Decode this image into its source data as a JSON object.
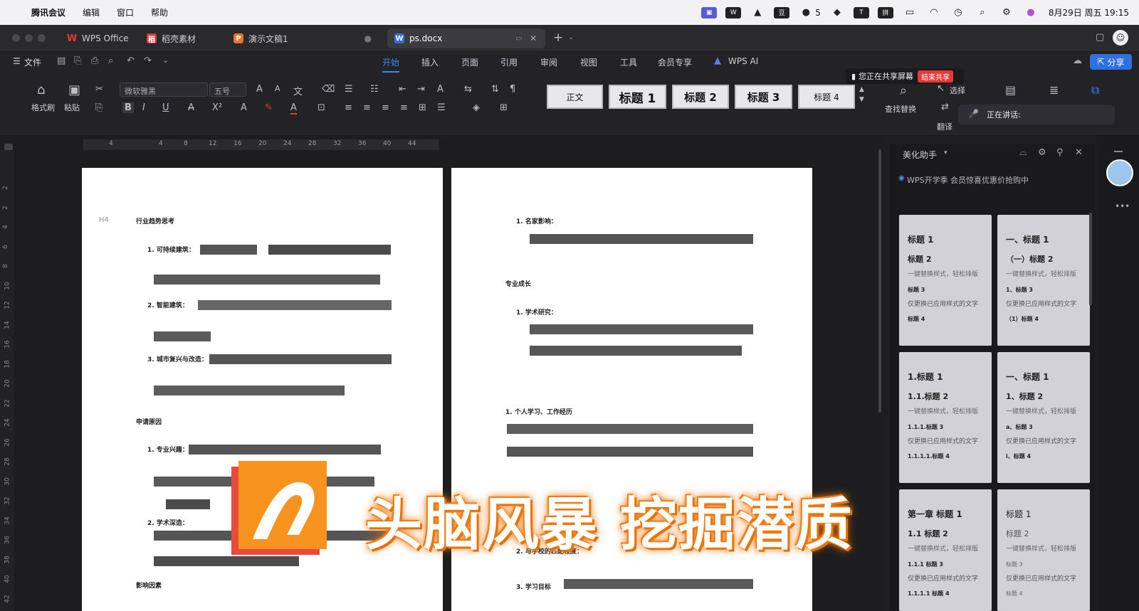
{
  "menubar": {
    "app": "腾讯会议",
    "items": [
      "编辑",
      "窗口",
      "帮助"
    ],
    "clock": "8月29日 周五 19:15",
    "wechat_count": "5"
  },
  "tabs": [
    {
      "label": "WPS Office",
      "icon": "wps-logo-icon"
    },
    {
      "label": "稻壳素材",
      "icon": "docer-icon"
    },
    {
      "label": "演示文稿1",
      "icon": "ppt-icon"
    },
    {
      "label": "ps.docx",
      "icon": "word-icon"
    }
  ],
  "toolbar": {
    "file": "文件",
    "menu_tabs": [
      "开始",
      "插入",
      "页面",
      "引用",
      "审阅",
      "视图",
      "工具",
      "会员专享",
      "WPS AI"
    ],
    "share": "分享"
  },
  "ribbon": {
    "format_painter": "格式刷",
    "paste": "粘贴",
    "font": "微软雅黑",
    "size": "五号",
    "styles": [
      "正文",
      "标题 1",
      "标题 2",
      "标题 3",
      "标题 4"
    ],
    "find_replace": "查找替换",
    "select": "选择",
    "translate": "翻译"
  },
  "share": {
    "notice": "您正在共享屏幕",
    "end": "结束共享",
    "speaking": "正在讲话:"
  },
  "ruler": [
    "4",
    "4",
    "8",
    "12",
    "16",
    "20",
    "24",
    "28",
    "32",
    "36",
    "40",
    "44"
  ],
  "vruler": [
    "2",
    "2",
    "4",
    "6",
    "8",
    "10",
    "12",
    "14",
    "16",
    "18",
    "20",
    "22",
    "24",
    "26",
    "28",
    "30",
    "32",
    "34",
    "36",
    "38",
    "40",
    "42"
  ],
  "page1": {
    "heading": "行业趋势思考",
    "items": [
      "1.  可持续建筑：",
      "2.  智能建筑：",
      "3.  城市复兴与改造："
    ],
    "section2": "申请原因",
    "items2": [
      "1.  专业兴趣：",
      "2.  学术深造："
    ],
    "section3": "影响因素",
    "marker": "H4"
  },
  "page2": {
    "item_a": "1.  名家影响：",
    "section_a": "专业成长",
    "item_b": "1.  学术研究：",
    "section_b": "1. 个人学习、工作经历",
    "item_c": "2.  与学校的匹配程度：",
    "item_d": "3.  学习目标"
  },
  "sidepanel": {
    "title": "美化助手",
    "promo": "WPS开学季 会员惊喜优惠价抢购中",
    "cards": [
      {
        "l1": "标题 1",
        "l2": "标题 2",
        "l3": "一键替换样式，轻松排版",
        "l4": "标题 3",
        "l5": "仅更换已应用样式的文字",
        "l6": "标题 4"
      },
      {
        "l1": "一、标题 1",
        "l2": "（一）标题 2",
        "l3": "一键替换样式，轻松排版",
        "l4": "1、标题 3",
        "l5": "仅更换已应用样式的文字",
        "l6": "（1）标题 4"
      },
      {
        "l1": "1.标题 1",
        "l2": "1.1.标题 2",
        "l3": "一键替换样式，轻松排版",
        "l4": "1.1.1.标题 3",
        "l5": "仅更换已应用样式的文字",
        "l6": "1.1.1.1.标题 4"
      },
      {
        "l1": "一、标题 1",
        "l2": "1、标题 2",
        "l3": "一键替换样式，轻松排版",
        "l4": "a、标题 3",
        "l5": "仅更换已应用样式的文字",
        "l6": "i、标题 4"
      },
      {
        "l1": "第一章  标题 1",
        "l2": "1.1 标题 2",
        "l3": "一键替换样式，轻松排版",
        "l4": "1.1.1 标题 3",
        "l5": "仅更换已应用样式的文字",
        "l6": "1.1.1.1 标题 4"
      },
      {
        "l1": "标题 1",
        "l2": "标题 2",
        "l3": "一键替换样式，轻松排版",
        "l4": "标题 3",
        "l5": "仅更换已应用样式的文字",
        "l6": "标题 4"
      }
    ]
  },
  "overlay": {
    "text": "头脑风暴 挖掘潜质"
  }
}
